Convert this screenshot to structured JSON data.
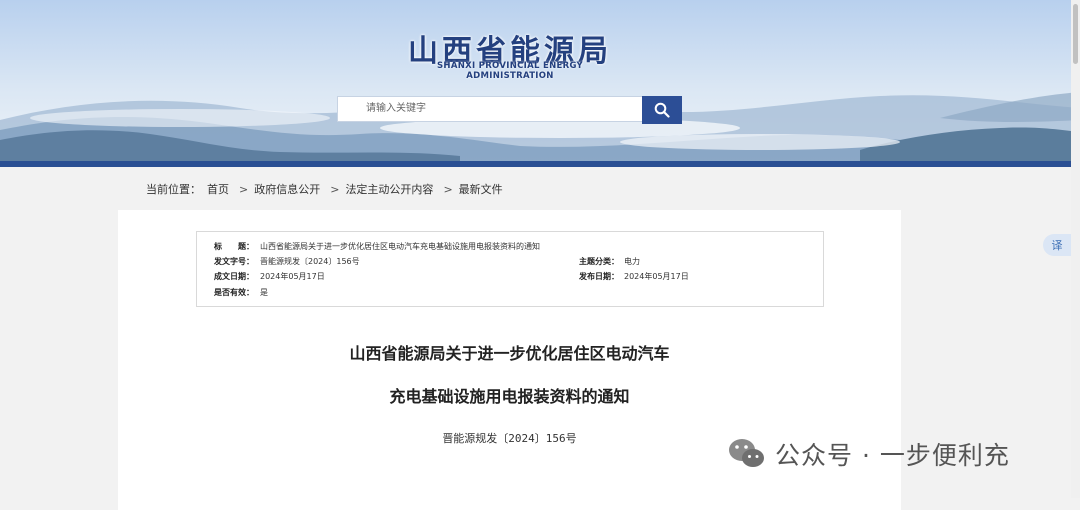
{
  "header": {
    "logo_title": "山西省能源局",
    "logo_subtitle": "SHANXI PROVINCIAL ENERGY ADMINISTRATION",
    "search_placeholder": "请输入关键字",
    "search_icon": "search-icon"
  },
  "breadcrumb": {
    "prefix": "当前位置：",
    "items": [
      "首页",
      "政府信息公开",
      "法定主动公开内容",
      "最新文件"
    ],
    "separator": ">"
  },
  "meta": {
    "title_label": "标　　题：",
    "title_value": "山西省能源局关于进一步优化居住区电动汽车充电基础设施用电报装资料的通知",
    "doc_no_label": "发文字号：",
    "doc_no_value": "晋能源规发〔2024〕156号",
    "topic_label": "主题分类：",
    "topic_value": "电力",
    "written_label": "成文日期：",
    "written_value": "2024年05月17日",
    "publish_label": "发布日期：",
    "publish_value": "2024年05月17日",
    "valid_label": "是否有效：",
    "valid_value": "是"
  },
  "document": {
    "title_line1": "山西省能源局关于进一步优化居住区电动汽车",
    "title_line2": "充电基础设施用电报装资料的通知",
    "doc_number": "晋能源规发〔2024〕156号"
  },
  "side": {
    "tab_label": "译"
  },
  "watermark": {
    "text": "公众号 · 一步便利充",
    "icon": "wechat-icon"
  },
  "colors": {
    "brand_blue": "#2c4e96",
    "banner_bottom": "#2a4f93"
  }
}
